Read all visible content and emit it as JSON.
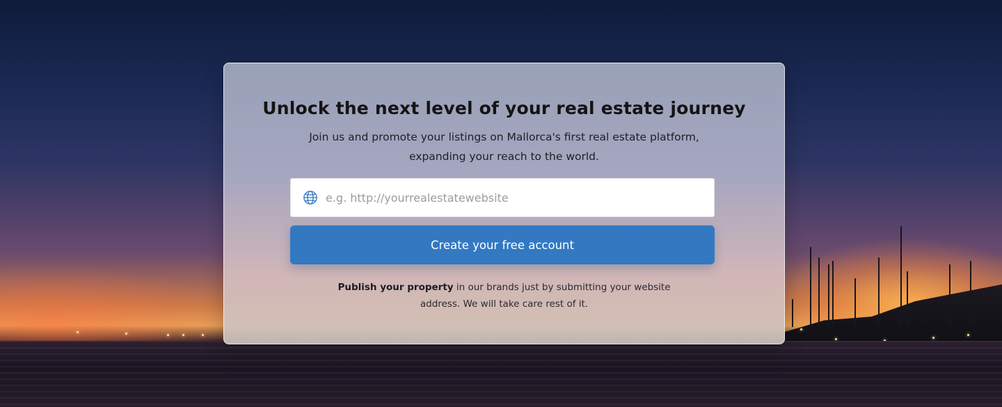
{
  "signup": {
    "title": "Unlock the next level of your real estate journey",
    "subtitle": "Join us and promote your listings on Mallorca's first real estate platform, expanding your reach to the world.",
    "website_field": {
      "placeholder": "e.g. http://yourrealestatewebsite",
      "value": "",
      "icon": "globe-icon"
    },
    "cta_label": "Create your free account",
    "footnote_bold": "Publish your property",
    "footnote_rest": " in our brands just by submitting your website address. We will take care rest of it."
  },
  "colors": {
    "accent": "#3279c2",
    "title": "#141414"
  },
  "background": {
    "description_icon": "harbor-sunset-image"
  }
}
